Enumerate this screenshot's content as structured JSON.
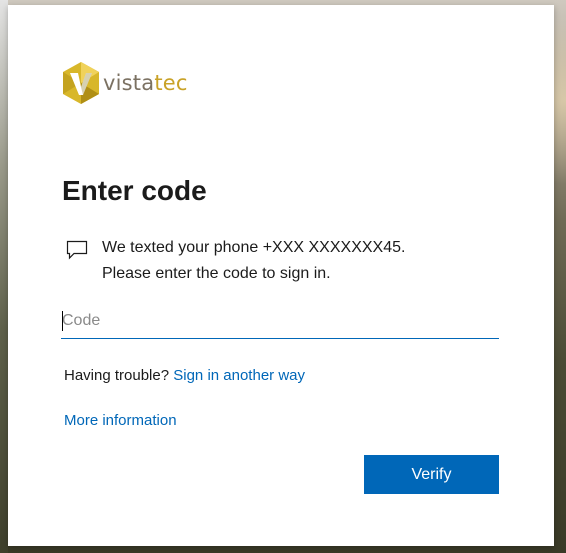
{
  "brand": {
    "name_part1": "vista",
    "name_part2": "tec",
    "colors": {
      "mark_gold": "#d8b72a",
      "mark_dark": "#8c7a1d",
      "text_gray": "#7b7162",
      "text_gold": "#c9a227"
    }
  },
  "page": {
    "title": "Enter code"
  },
  "message": {
    "icon": "chat-bubble-icon",
    "line1": "We texted your phone +XXX XXXXXXX45.",
    "line2": "Please enter the code to sign in."
  },
  "code_field": {
    "placeholder": "Code",
    "value": ""
  },
  "help": {
    "trouble_text": "Having trouble?",
    "alt_link": "Sign in another way",
    "more_info_link": "More information"
  },
  "actions": {
    "verify_label": "Verify"
  },
  "colors": {
    "accent": "#0067b8",
    "text": "#1b1b1b"
  }
}
